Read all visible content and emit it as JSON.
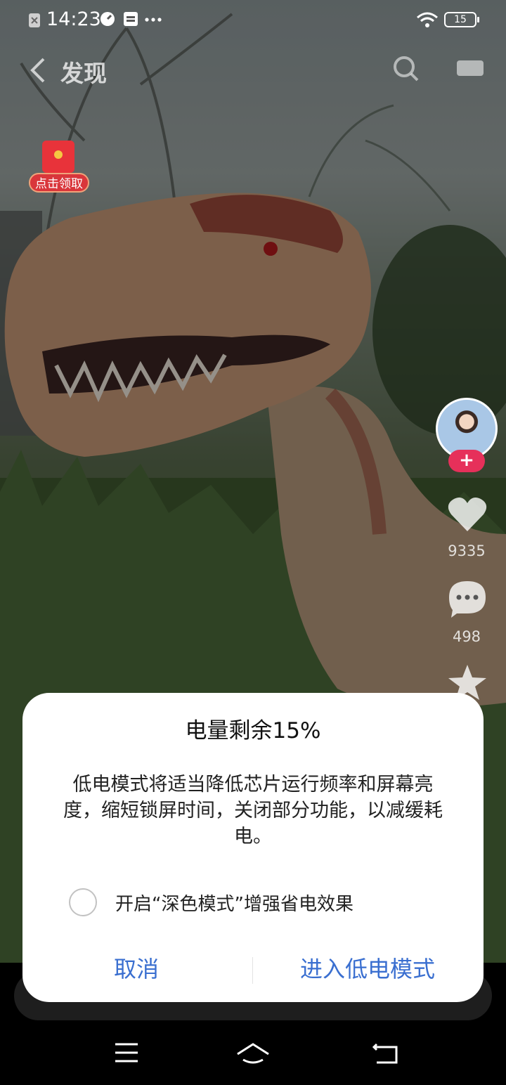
{
  "status_bar": {
    "time": "14:23",
    "battery": "15"
  },
  "top_nav": {
    "title": "发现"
  },
  "red_packet": {
    "label": "点击领取"
  },
  "right_rail": {
    "likes": "9335",
    "comments": "498"
  },
  "dialog": {
    "title": "电量剩余15%",
    "body": "低电模式将适当降低芯片运行频率和屏幕亮度，缩短锁屏时间，关闭部分功能，以减缓耗电。",
    "checkbox_label": "开启“深色模式”增强省电效果",
    "cancel_label": "取消",
    "confirm_label": "进入低电模式"
  },
  "colors": {
    "accent": "#3a6fd0",
    "follow": "#e6305a",
    "redpacket": "#d9363b"
  }
}
